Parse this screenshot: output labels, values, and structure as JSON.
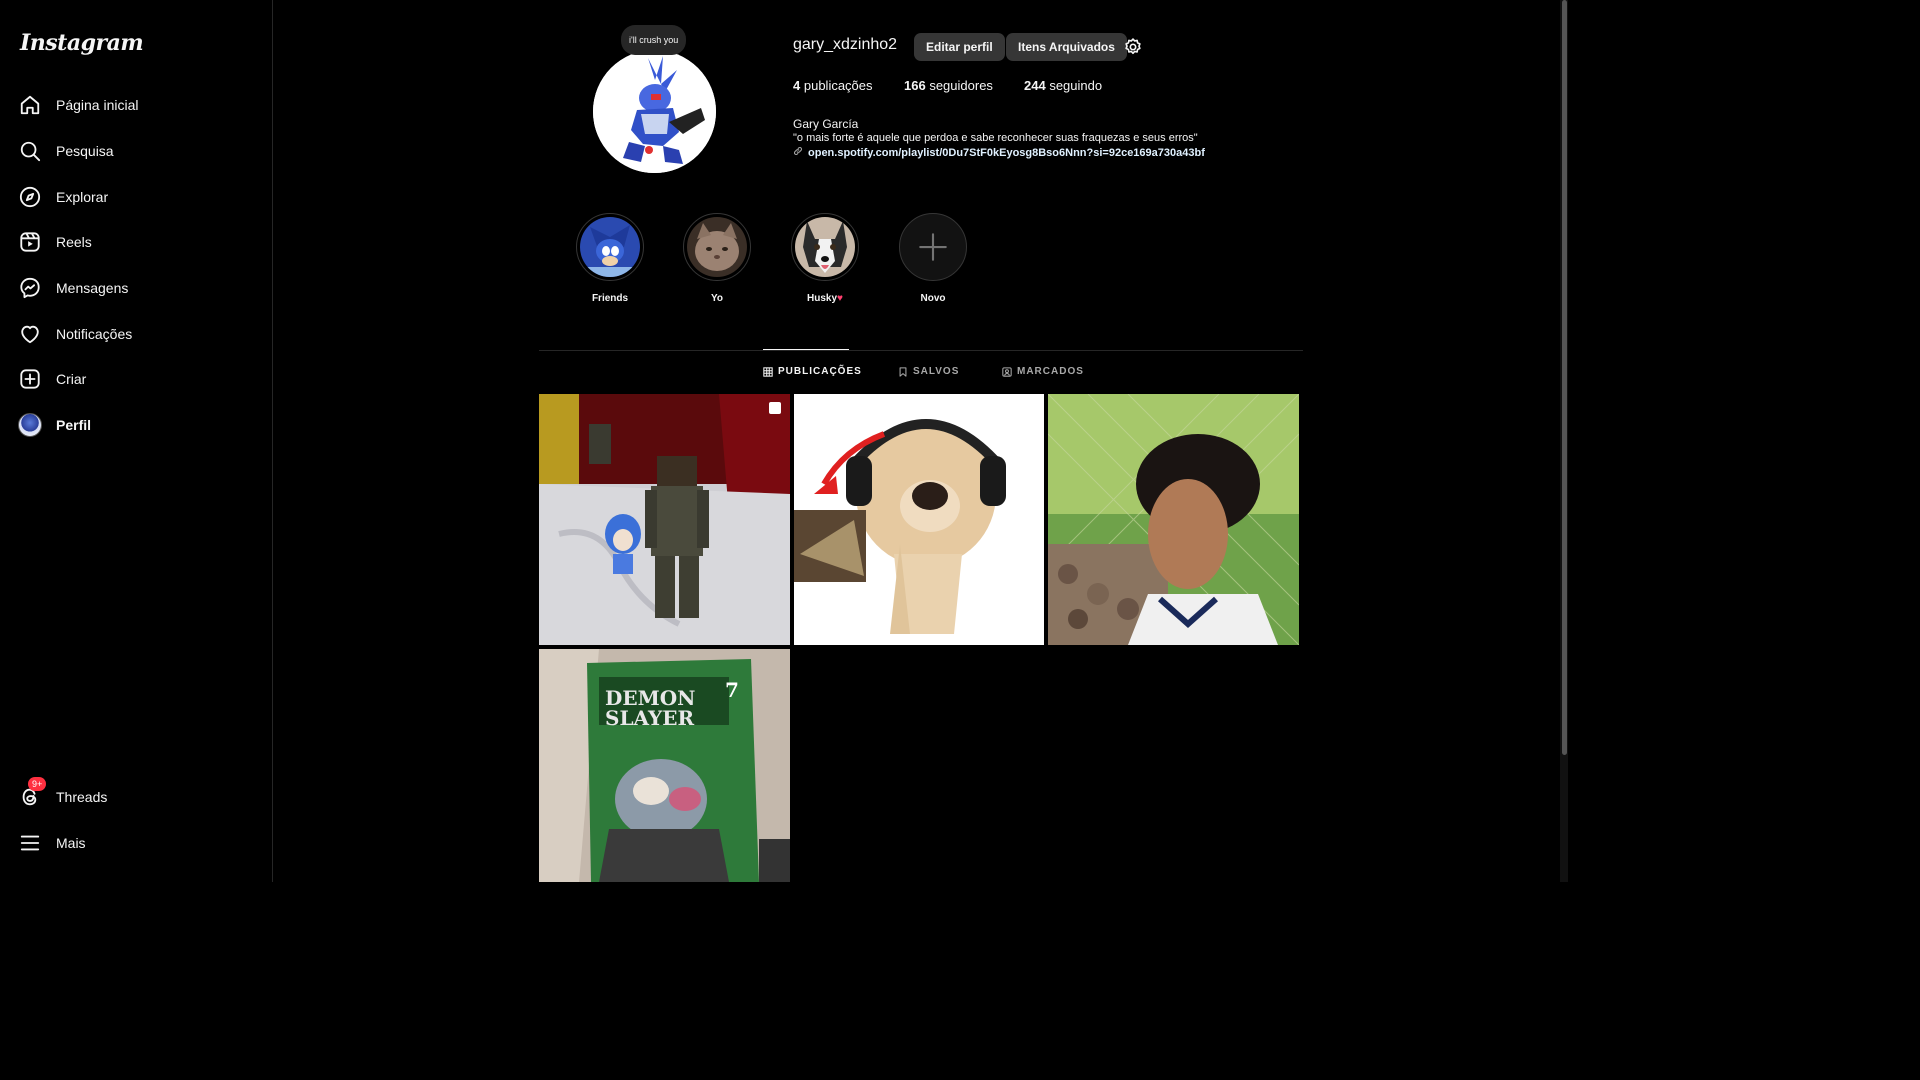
{
  "app": {
    "logo": "Instagram"
  },
  "sidebar": {
    "items": [
      {
        "label": "Página inicial",
        "icon": "home-icon"
      },
      {
        "label": "Pesquisa",
        "icon": "search-icon"
      },
      {
        "label": "Explorar",
        "icon": "compass-icon"
      },
      {
        "label": "Reels",
        "icon": "reels-icon"
      },
      {
        "label": "Mensagens",
        "icon": "messenger-icon"
      },
      {
        "label": "Notificações",
        "icon": "heart-icon"
      },
      {
        "label": "Criar",
        "icon": "plus-square-icon"
      },
      {
        "label": "Perfil",
        "icon": "avatar"
      }
    ],
    "threads": {
      "label": "Threads",
      "badge": "9+"
    },
    "more": {
      "label": "Mais"
    }
  },
  "profile": {
    "note": "i'll crush you",
    "username": "gary_xdzinho2",
    "edit_button": "Editar perfil",
    "archive_button": "Itens Arquivados",
    "stats": {
      "posts_count": "4",
      "posts_label": "publicações",
      "followers_count": "166",
      "followers_label": "seguidores",
      "following_count": "244",
      "following_label": "seguindo"
    },
    "full_name": "Gary García",
    "bio": "\"o mais forte é aquele que perdoa e sabe reconhecer suas fraquezas e seus erros\"",
    "link": "open.spotify.com/playlist/0Du7StF0kEyosg8Bso6Nnn?si=92ce169a730a43bf"
  },
  "highlights": [
    {
      "name": "Friends"
    },
    {
      "name": "Yo"
    },
    {
      "name": "Husky"
    },
    {
      "name": "Novo"
    }
  ],
  "tabs": [
    {
      "label": "PUBLICAÇÕES",
      "active": true
    },
    {
      "label": "SALVOS",
      "active": false
    },
    {
      "label": "MARCADOS",
      "active": false
    }
  ],
  "colors": {
    "background": "#000000",
    "badge": "#ff3040",
    "button": "#363636"
  }
}
